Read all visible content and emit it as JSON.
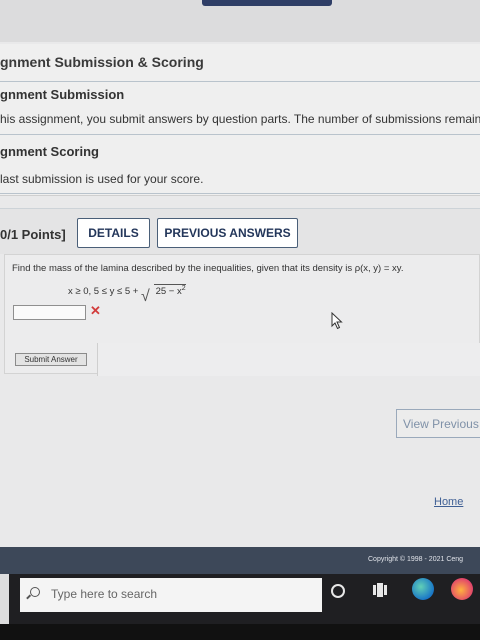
{
  "panel": {
    "title": "gnment Submission & Scoring",
    "submission_heading": "gnment Submission",
    "submission_text": "his assignment, you submit answers by question parts. The number of submissions remainin",
    "scoring_heading": "gnment Scoring",
    "scoring_text": "last submission is used for your score."
  },
  "question": {
    "points": "0/1 Points]",
    "details_label": "DETAILS",
    "previous_answers_label": "PREVIOUS ANSWERS",
    "prompt": "Find the mass of the lamina described by the inequalities, given that its density is ρ(x, y) = xy.",
    "ineq_prefix": "x ≥ 0, 5 ≤ y ≤ 5 +",
    "ineq_radicand": "25 − x",
    "ineq_exponent": "2",
    "answer_value": "",
    "result_mark": "✕",
    "submit_label": "Submit Answer"
  },
  "view_previous_label": "View Previous Q",
  "home_label": "Home",
  "footer": {
    "copyright": "Copyright © 1998 - 2021 Ceng"
  },
  "taskbar": {
    "search_placeholder": "Type here to search"
  },
  "colors": {
    "accent": "#23365a",
    "error": "#d23c3c",
    "footer": "#3d4859"
  }
}
